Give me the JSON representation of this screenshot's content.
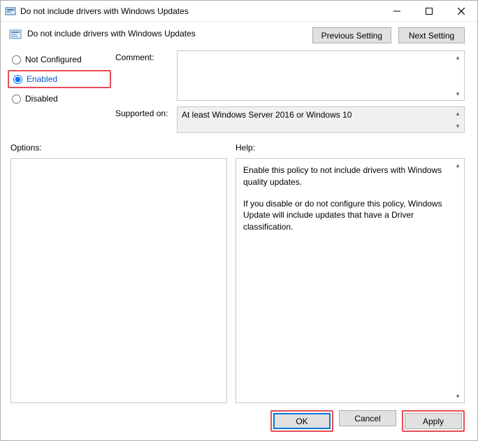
{
  "titlebar": {
    "title": "Do not include drivers with Windows Updates"
  },
  "header": {
    "title": "Do not include drivers with Windows Updates",
    "prev": "Previous Setting",
    "next": "Next Setting"
  },
  "radios": {
    "not_configured": "Not Configured",
    "enabled": "Enabled",
    "disabled": "Disabled",
    "selected": "enabled"
  },
  "fields": {
    "comment_label": "Comment:",
    "comment_value": "",
    "supported_label": "Supported on:",
    "supported_value": "At least Windows Server 2016 or Windows 10"
  },
  "section_labels": {
    "options": "Options:",
    "help": "Help:"
  },
  "help": {
    "p1": "Enable this policy to not include drivers with Windows quality updates.",
    "p2": "If you disable or do not configure this policy, Windows Update will include updates that have a Driver classification."
  },
  "footer": {
    "ok": "OK",
    "cancel": "Cancel",
    "apply": "Apply"
  }
}
